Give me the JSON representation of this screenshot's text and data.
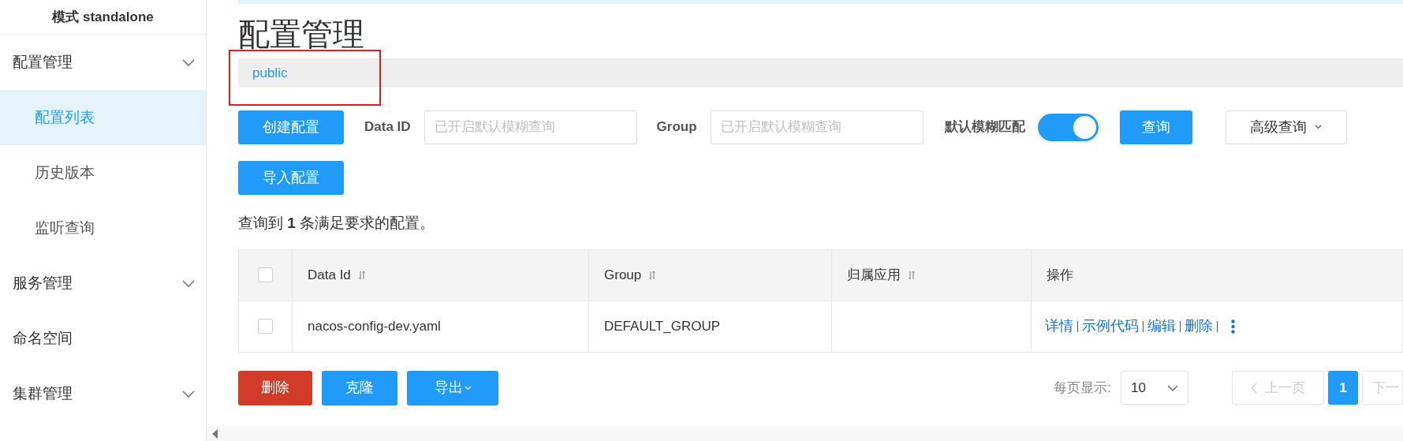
{
  "sidebar": {
    "mode_label": "模式 standalone",
    "items": [
      {
        "label": "配置管理",
        "kind": "group",
        "selected": false,
        "children": [
          {
            "label": "配置列表",
            "selected": true
          },
          {
            "label": "历史版本",
            "selected": false
          },
          {
            "label": "监听查询",
            "selected": false
          }
        ]
      },
      {
        "label": "服务管理",
        "kind": "group",
        "selected": false
      },
      {
        "label": "命名空间",
        "kind": "link",
        "selected": false
      },
      {
        "label": "集群管理",
        "kind": "group",
        "selected": false
      }
    ]
  },
  "page_title": "配置管理",
  "namespace_tabs": [
    {
      "label": "public",
      "selected": true
    }
  ],
  "toolbar": {
    "create_button": "创建配置",
    "data_id_label": "Data ID",
    "data_id_placeholder": "已开启默认模糊查询",
    "group_label": "Group",
    "group_placeholder": "已开启默认模糊查询",
    "fuzzy_label": "默认模糊匹配",
    "fuzzy_on": true,
    "search_button": "查询",
    "advanced_button": "高级查询",
    "import_button": "导入配置"
  },
  "summary": "查询到 **1** 条满足要求的配置。",
  "table": {
    "select_all_checked": false,
    "columns": [
      {
        "label": "Data Id",
        "sortable": true
      },
      {
        "label": "Group",
        "sortable": true
      },
      {
        "label": "归属应用",
        "sortable": true
      },
      {
        "label": "操作",
        "sortable": false
      }
    ],
    "rows": [
      {
        "checked": false,
        "data_id": "nacos-config-dev.yaml",
        "group": "DEFAULT_GROUP",
        "actions": [
          "详情",
          "示例代码",
          "编辑",
          "删除"
        ]
      }
    ]
  },
  "bulk_actions": [
    {
      "label": "删除",
      "kind": "danger",
      "dropdown": false
    },
    {
      "label": "克隆",
      "kind": "primary",
      "dropdown": false
    },
    {
      "label": "导出",
      "kind": "primary",
      "dropdown": true
    }
  ],
  "pagination": {
    "page_size_label": "每页显示:",
    "page_size": "10",
    "prev": {
      "label": "上一页",
      "disabled": true
    },
    "pages": [
      {
        "label": "1",
        "selected": true
      }
    ],
    "next": {
      "label": "下一",
      "disabled": true
    }
  }
}
